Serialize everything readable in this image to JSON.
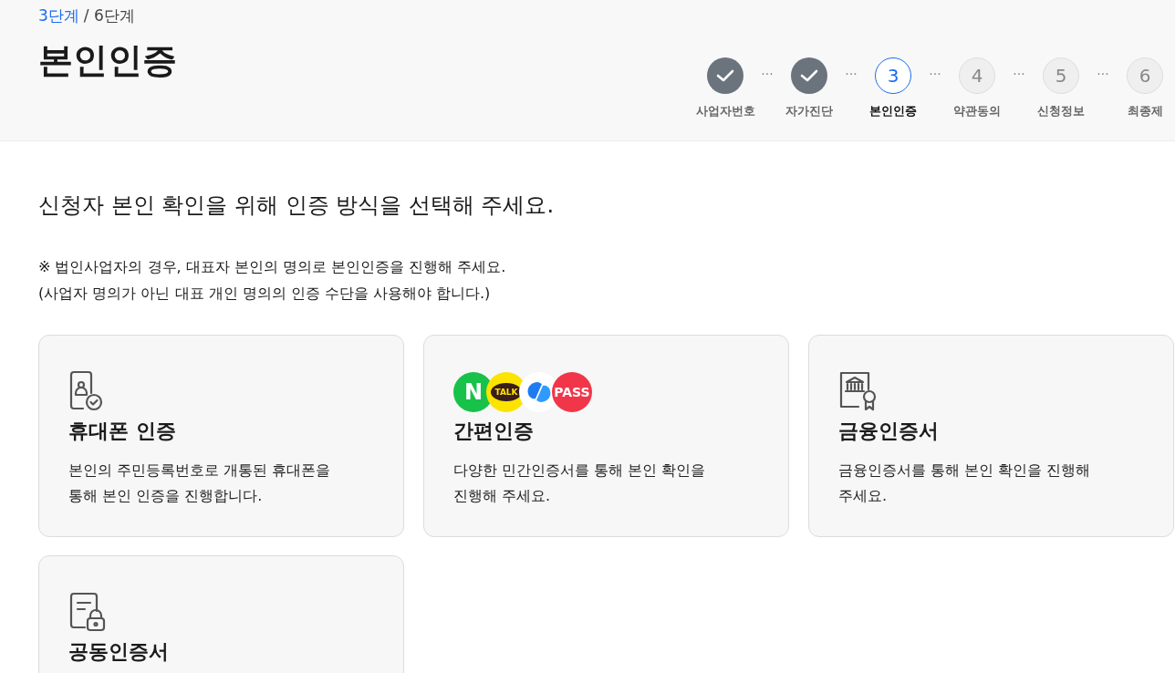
{
  "header": {
    "step_current": "3단계",
    "step_total": "/ 6단계",
    "title": "본인인증"
  },
  "steps": [
    {
      "label": "사업자번호",
      "done": true,
      "selected": false
    },
    {
      "label": "자가진단",
      "done": true,
      "selected": false
    },
    {
      "number": "3",
      "label": "본인인증",
      "done": false,
      "selected": true
    },
    {
      "number": "4",
      "label": "약관동의",
      "done": false,
      "selected": false
    },
    {
      "number": "5",
      "label": "신청정보",
      "done": false,
      "selected": false
    },
    {
      "number": "6",
      "label": "최종제",
      "done": false,
      "selected": false
    }
  ],
  "step_separator": "···",
  "intro": "신청자 본인 확인을 위해 인증 방식을 선택해 주세요.",
  "notice": [
    "※ 법인사업자의 경우, 대표자 본인의 명의로 본인인증을 진행해 주세요.",
    "(사업자 명의가 아닌 대표 개인 명의의 인증 수단을 사용해야 합니다.)"
  ],
  "methods": [
    {
      "kind": "phone",
      "title": "휴대폰 인증",
      "description": "본인의 주민등록번호로 개통된 휴대폰을\n통해 본인 인증을 진행합니다."
    },
    {
      "kind": "simple",
      "title": "간편인증",
      "description": "다양한 민간인증서를 통해 본인 확인을\n진행해 주세요.",
      "logos": [
        {
          "kind": "n",
          "text": "N"
        },
        {
          "kind": "talk",
          "text": "TALK"
        },
        {
          "kind": "swirl"
        },
        {
          "kind": "pass",
          "text": "PASS"
        }
      ]
    },
    {
      "kind": "finance",
      "title": "금융인증서",
      "description": "금융인증서를 통해 본인 확인을 진행해\n주세요."
    },
    {
      "kind": "joint",
      "title": "공동인증서"
    }
  ]
}
